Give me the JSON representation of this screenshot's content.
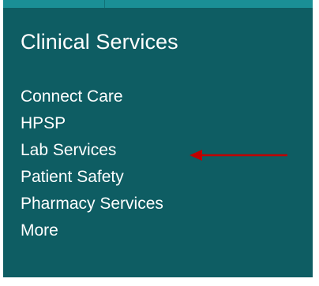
{
  "panel": {
    "title": "Clinical Services",
    "links": [
      {
        "label": "Connect Care"
      },
      {
        "label": "HPSP"
      },
      {
        "label": "Lab Services"
      },
      {
        "label": "Patient Safety"
      },
      {
        "label": "Pharmacy Services"
      },
      {
        "label": "More"
      }
    ]
  },
  "colors": {
    "panel_background": "#0e5d63",
    "top_accent": "#1a8f96",
    "text": "#ffffff",
    "annotation_arrow": "#c00000"
  },
  "annotation": {
    "icon": "arrow-left-icon",
    "points_to_link_index": 2
  }
}
